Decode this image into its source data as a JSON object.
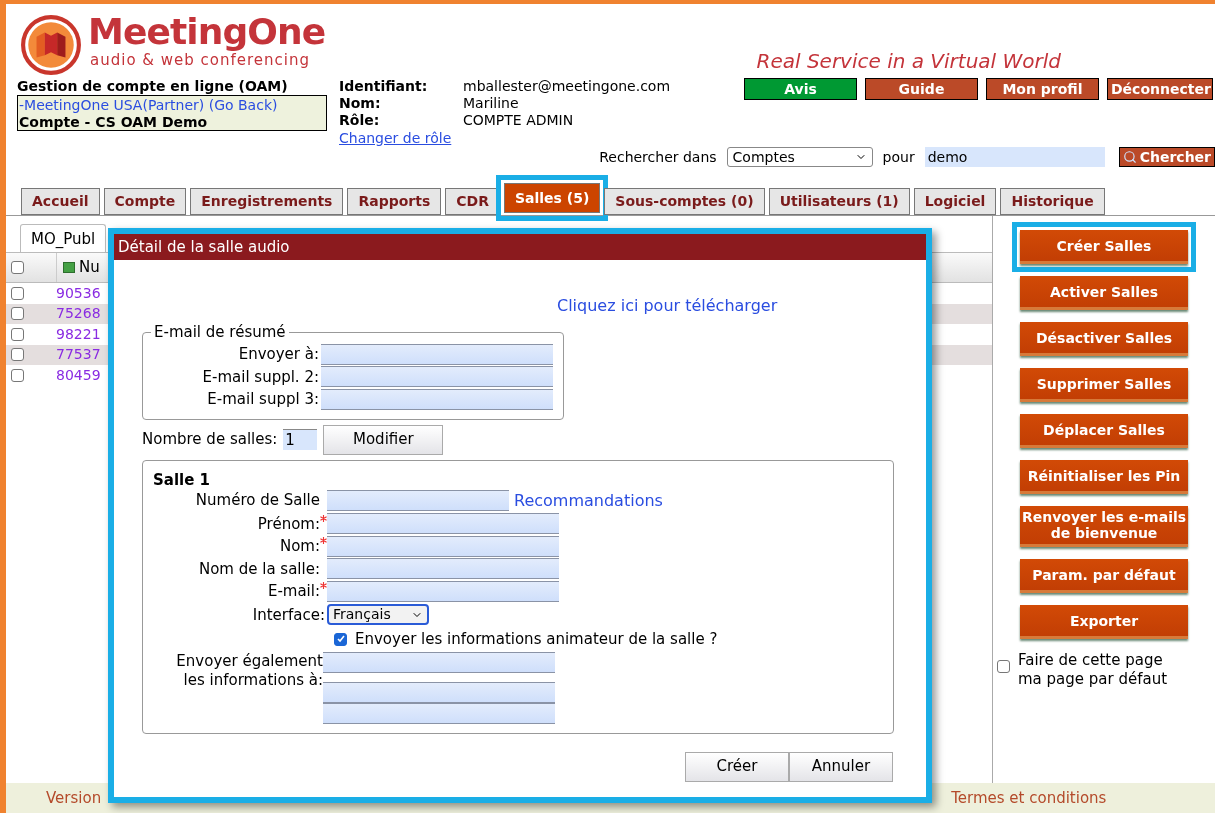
{
  "header": {
    "brand": "MeetingOne",
    "tagline": "audio & web conferencing",
    "slogan": "Real Service in a Virtual World",
    "top_buttons": [
      {
        "label": "Avis",
        "color": "#009933"
      },
      {
        "label": "Guide",
        "color": "#bb4a28"
      },
      {
        "label": "Mon profil",
        "color": "#bb4a28"
      },
      {
        "label": "Déconnecter",
        "color": "#bb4a28"
      }
    ],
    "account_box": {
      "title": "Gestion de compte en ligne (OAM)",
      "link": "-MeetingOne USA(Partner) (Go Back)",
      "account": "Compte - CS OAM Demo"
    },
    "identity": [
      {
        "label": "Identifiant:",
        "value": "mballester@meetingone.com"
      },
      {
        "label": "Nom:",
        "value": "Mariline"
      },
      {
        "label": "Rôle:",
        "value": "COMPTE ADMIN"
      }
    ],
    "change_role": "Changer de rôle"
  },
  "search": {
    "label": "Rechercher dans",
    "scope": "Comptes",
    "for_label": "pour",
    "query": "demo",
    "button": "Chercher"
  },
  "tabs": [
    {
      "label": "Accueil",
      "selected": false,
      "highlighted": false
    },
    {
      "label": "Compte",
      "selected": false,
      "highlighted": false
    },
    {
      "label": "Enregistrements",
      "selected": false,
      "highlighted": false
    },
    {
      "label": "Rapports",
      "selected": false,
      "highlighted": false
    },
    {
      "label": "CDR",
      "selected": false,
      "highlighted": false
    },
    {
      "label": "Salles (5)",
      "selected": true,
      "highlighted": true
    },
    {
      "label": "Sous-comptes (0)",
      "selected": false,
      "highlighted": false
    },
    {
      "label": "Utilisateurs (1)",
      "selected": false,
      "highlighted": false
    },
    {
      "label": "Logiciel",
      "selected": false,
      "highlighted": false
    },
    {
      "label": "Historique",
      "selected": false,
      "highlighted": false
    }
  ],
  "rooms_panel": {
    "tab": "MO_Publ",
    "column": "Nu",
    "header_checked": false,
    "rows": [
      {
        "number": "90536",
        "checked": false
      },
      {
        "number": "75268",
        "checked": false
      },
      {
        "number": "98221",
        "checked": false
      },
      {
        "number": "77537",
        "checked": false
      },
      {
        "number": "80459",
        "checked": false
      }
    ]
  },
  "sidebar": {
    "buttons": [
      {
        "label": "Créer Salles",
        "highlighted": true
      },
      {
        "label": "Activer Salles",
        "highlighted": false
      },
      {
        "label": "Désactiver Salles",
        "highlighted": false
      },
      {
        "label": "Supprimer Salles",
        "highlighted": false
      },
      {
        "label": "Déplacer Salles",
        "highlighted": false
      },
      {
        "label": "Réinitialiser les Pin",
        "highlighted": false
      },
      {
        "label": "Renvoyer les e-mails de bienvenue",
        "highlighted": false
      },
      {
        "label": "Param. par défaut",
        "highlighted": false
      },
      {
        "label": "Exporter",
        "highlighted": false
      }
    ],
    "default_page": {
      "label": "Faire de cette page ma page par défaut",
      "checked": false
    }
  },
  "dialog": {
    "title": "Détail de la salle audio",
    "highlighted": true,
    "download_link": "Cliquez ici pour télécharger",
    "summary": {
      "legend": "E-mail de résumé",
      "fields": [
        "Envoyer à:",
        "E-mail suppl. 2:",
        "E-mail suppl 3:"
      ]
    },
    "count": {
      "label": "Nombre de salles:",
      "value": "1",
      "button": "Modifier"
    },
    "room": {
      "legend": "Salle 1",
      "recommendations": "Recommandations",
      "fields": [
        {
          "label": "Numéro de Salle",
          "required": false
        },
        {
          "label": "Prénom:",
          "required": true
        },
        {
          "label": "Nom:",
          "required": true
        },
        {
          "label": "Nom de la salle:",
          "required": false
        },
        {
          "label": "E-mail:",
          "required": true
        }
      ],
      "interface": {
        "label": "Interface:",
        "value": "Français"
      },
      "send_host_info": {
        "label": "Envoyer les informations animateur de la salle ?",
        "checked": true
      },
      "also_send": {
        "label": "Envoyer également les informations à:"
      }
    },
    "buttons": [
      "Créer",
      "Annuler"
    ]
  },
  "footer": [
    "Version",
    "Termes et conditions"
  ]
}
